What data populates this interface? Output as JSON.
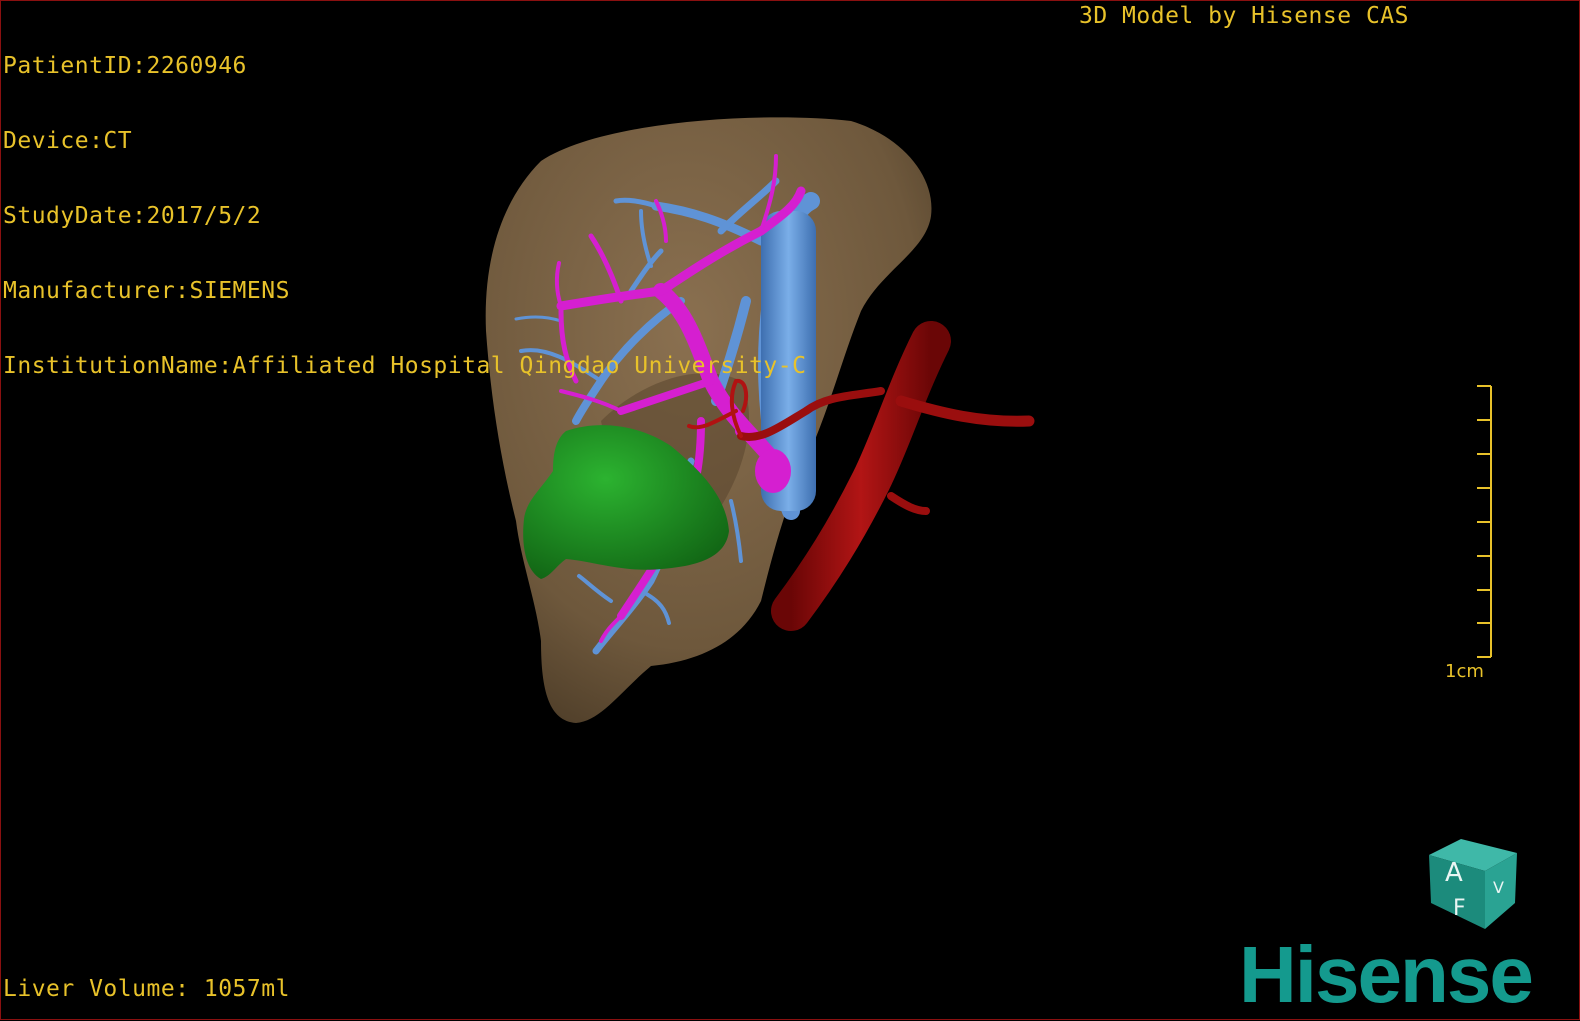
{
  "header": {
    "patient_id": "PatientID:2260946",
    "device": "Device:CT",
    "study_date": "StudyDate:2017/5/2",
    "manufacturer": "Manufacturer:SIEMENS",
    "institution": "InstitutionName:Affiliated Hospital Qingdao University-C",
    "credit": "3D Model by Hisense CAS"
  },
  "footer": {
    "liver_volume": "Liver Volume: 1057ml"
  },
  "scale_bar": {
    "label": "1cm"
  },
  "orientation_cube": {
    "face_front": "A",
    "face_side": "V",
    "face_bottom": "F"
  },
  "brand": {
    "name": "Hisense"
  },
  "colors": {
    "text": "#e8c22a",
    "liver": "#7b6445",
    "portal_vein": "#d51fd0",
    "hepatic_vein": "#5f93d6",
    "tumor": "#1d8a21",
    "artery": "#9a0e0e",
    "brand": "#149a8e"
  }
}
